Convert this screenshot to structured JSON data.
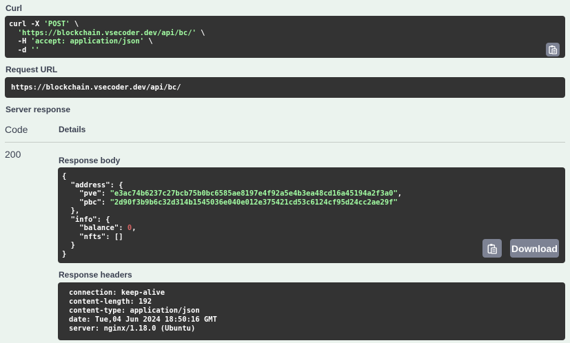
{
  "curl": {
    "label": "Curl",
    "line1_cmd": "curl -X ",
    "line1_method": "'POST'",
    "line1_tail": " \\",
    "line2_url": "'https://blockchain.vsecoder.dev/api/bc/'",
    "line2_tail": " \\",
    "line3_flag": "-H ",
    "line3_header": "'accept: application/json'",
    "line3_tail": " \\",
    "line4_flag": "-d ",
    "line4_data": "''"
  },
  "request_url": {
    "label": "Request URL",
    "value": "https://blockchain.vsecoder.dev/api/bc/"
  },
  "server_response": {
    "label": "Server response",
    "code_header": "Code",
    "details_header": "Details",
    "code": "200"
  },
  "response_body": {
    "label": "Response body",
    "open_brace": "{",
    "address_key": "\"address\"",
    "address_open": ": {",
    "pve_key": "\"pve\"",
    "pve_value": "\"e3ac74b6237c27bcb75b0bc6585ae8197e4f92a5e4b3ea48cd16a45194a2f3a0\"",
    "pbc_key": "\"pbc\"",
    "pbc_value": "\"2d90f3b9b6c32d314b1545036e040e012e375421cd53c6124cf95d24cc2ae29f\"",
    "address_close": "},",
    "info_key": "\"info\"",
    "info_open": ": {",
    "balance_key": "\"balance\"",
    "balance_value": "0",
    "nfts_key": "\"nfts\"",
    "nfts_value": ": []",
    "info_close": "}",
    "close_brace": "}",
    "download_label": "Download"
  },
  "response_headers": {
    "label": "Response headers",
    "lines": [
      "connection: keep-alive",
      "content-length: 192",
      "content-type: application/json",
      "date: Tue,04 Jun 2024 18:50:16 GMT",
      "server: nginx/1.18.0 (Ubuntu)"
    ]
  },
  "icons": {
    "copy": "clipboard-copy-icon"
  },
  "colors": {
    "background": "#ebf3ee",
    "code_bg": "#333333",
    "string": "#a2fca2",
    "number": "#d36363",
    "button": "#7d8293"
  }
}
